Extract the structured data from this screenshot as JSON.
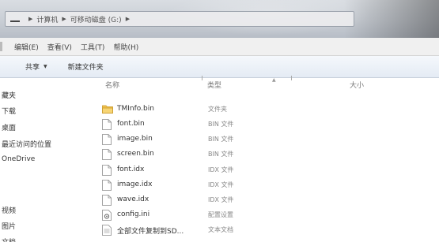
{
  "address": {
    "crumbs": [
      "计算机",
      "可移动磁盘 (G:)"
    ]
  },
  "menu": [
    {
      "label": "编辑(E)"
    },
    {
      "label": "查看(V)"
    },
    {
      "label": "工具(T)"
    },
    {
      "label": "帮助(H)"
    }
  ],
  "toolbar": {
    "share_label": "共享",
    "new_folder_label": "新建文件夹"
  },
  "nav": [
    {
      "label": "藏夹"
    },
    {
      "label": "下载"
    },
    {
      "label": "桌面"
    },
    {
      "label": "最近访问的位置"
    },
    {
      "label": "OneDrive"
    },
    {
      "label": "视频"
    },
    {
      "label": "图片"
    },
    {
      "label": "文档"
    }
  ],
  "columns": {
    "name": "名称",
    "type": "类型",
    "size": "大小"
  },
  "files": [
    {
      "name": "TMInfo.bin",
      "type": "文件夹",
      "icon": "folder-icon"
    },
    {
      "name": "font.bin",
      "type": "BIN 文件",
      "icon": "file-icon"
    },
    {
      "name": "image.bin",
      "type": "BIN 文件",
      "icon": "file-icon"
    },
    {
      "name": "screen.bin",
      "type": "BIN 文件",
      "icon": "file-icon"
    },
    {
      "name": "font.idx",
      "type": "IDX 文件",
      "icon": "file-icon"
    },
    {
      "name": "image.idx",
      "type": "IDX 文件",
      "icon": "file-icon"
    },
    {
      "name": "wave.idx",
      "type": "IDX 文件",
      "icon": "file-icon"
    },
    {
      "name": "config.ini",
      "type": "配置设置",
      "icon": "settings-file-icon"
    },
    {
      "name": "全部文件复制到SD...",
      "type": "文本文档",
      "icon": "text-file-icon"
    }
  ]
}
